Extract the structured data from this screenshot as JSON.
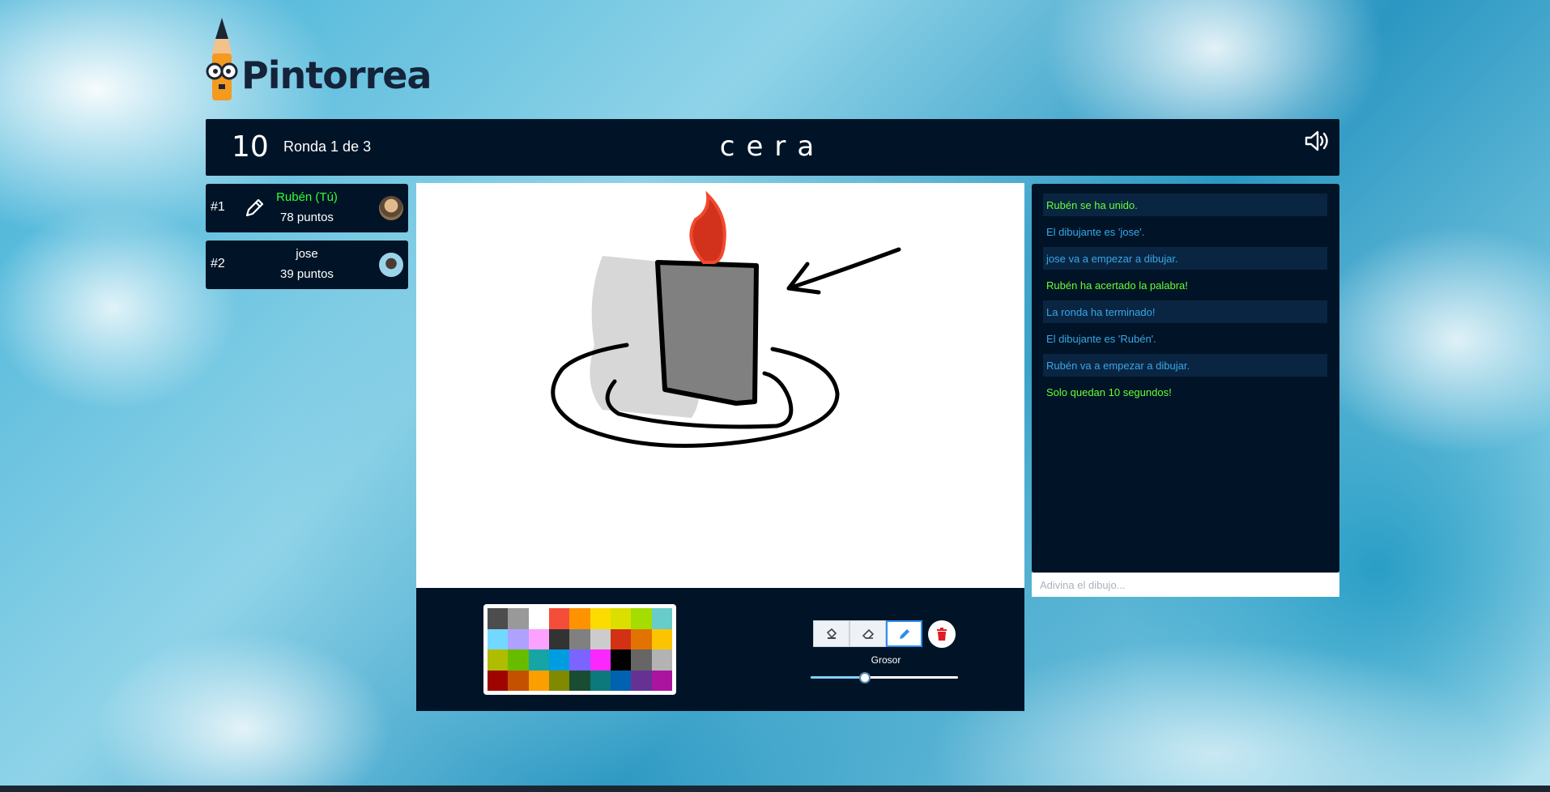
{
  "app": {
    "name": "Pintorrea"
  },
  "header": {
    "timer": "10",
    "round": "Ronda 1 de 3",
    "word": "cera"
  },
  "players": [
    {
      "rank": "#1",
      "name": "Rubén (Tú)",
      "points": "78 puntos",
      "drawing": true,
      "name_color": "#33ff33"
    },
    {
      "rank": "#2",
      "name": "jose",
      "points": "39 puntos",
      "drawing": false,
      "name_color": "#ffffff"
    }
  ],
  "chat": {
    "messages": [
      {
        "text": "Rubén se ha unido.",
        "color": "#66ff33"
      },
      {
        "text": "El dibujante es 'jose'.",
        "color": "#37a7e6"
      },
      {
        "text": "jose va a empezar a dibujar.",
        "color": "#37a7e6"
      },
      {
        "text": "Rubén ha acertado la palabra!",
        "color": "#66ff33"
      },
      {
        "text": "La ronda ha terminado!",
        "color": "#37a7e6"
      },
      {
        "text": "El dibujante es 'Rubén'.",
        "color": "#37a7e6"
      },
      {
        "text": "Rubén va a empezar a dibujar.",
        "color": "#37a7e6"
      },
      {
        "text": "Solo quedan 10 segundos!",
        "color": "#66ff33"
      }
    ],
    "input_placeholder": "Adivina el dibujo..."
  },
  "toolbar": {
    "palette": [
      "#4d4d4d",
      "#999999",
      "#ffffff",
      "#f44e3b",
      "#fe9200",
      "#fcdc00",
      "#dbdf00",
      "#a4dd00",
      "#68ccca",
      "#73d8ff",
      "#aea1ff",
      "#fda1ff",
      "#333333",
      "#808080",
      "#cccccc",
      "#d33115",
      "#e27300",
      "#fcc400",
      "#b0bc00",
      "#68bc00",
      "#16a5a5",
      "#009ce0",
      "#7b64ff",
      "#fa28ff",
      "#000000",
      "#666666",
      "#b3b3b3",
      "#9f0500",
      "#c45100",
      "#fb9e00",
      "#808900",
      "#194d33",
      "#0c797d",
      "#0062b1",
      "#653294",
      "#ab149e"
    ],
    "tools": [
      "bucket-icon",
      "eraser-icon",
      "pencil-icon"
    ],
    "active_tool": "pencil-icon",
    "size_label": "Grosor",
    "size_value": 0.37
  },
  "colors": {
    "panel": "#011427",
    "accent_green": "#66ff33",
    "accent_blue": "#37a7e6",
    "trash_red": "#e01b24"
  }
}
